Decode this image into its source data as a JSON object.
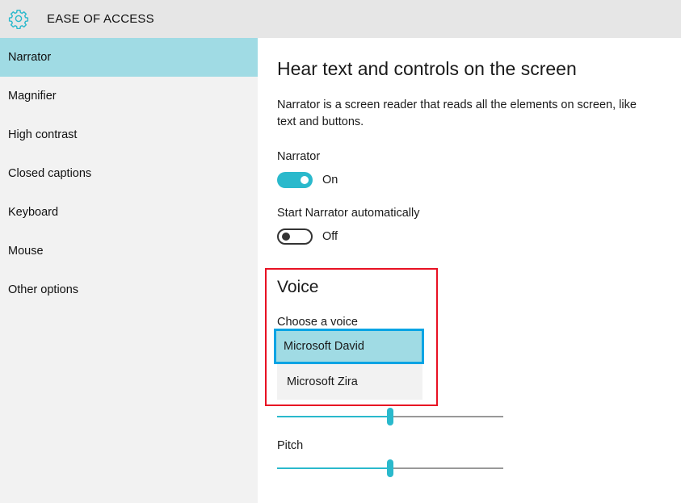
{
  "app": {
    "title": "EASE OF ACCESS",
    "icon": "gear-icon",
    "accent": "#2ab9cc"
  },
  "sidebar": {
    "items": [
      {
        "label": "Narrator",
        "active": true
      },
      {
        "label": "Magnifier"
      },
      {
        "label": "High contrast"
      },
      {
        "label": "Closed captions"
      },
      {
        "label": "Keyboard"
      },
      {
        "label": "Mouse"
      },
      {
        "label": "Other options"
      }
    ]
  },
  "main": {
    "heading": "Hear text and controls on the screen",
    "description": "Narrator is a screen reader that reads all the elements on screen, like text and buttons.",
    "narrator": {
      "label": "Narrator",
      "state": "On",
      "on": true
    },
    "start_auto": {
      "label": "Start Narrator automatically",
      "state": "Off",
      "on": false
    },
    "voice": {
      "heading": "Voice",
      "choose_label": "Choose a voice",
      "options": [
        "Microsoft David",
        "Microsoft Zira"
      ],
      "selected": "Microsoft David"
    },
    "speed": {
      "value_percent": 50
    },
    "pitch": {
      "label": "Pitch",
      "value_percent": 50
    }
  }
}
